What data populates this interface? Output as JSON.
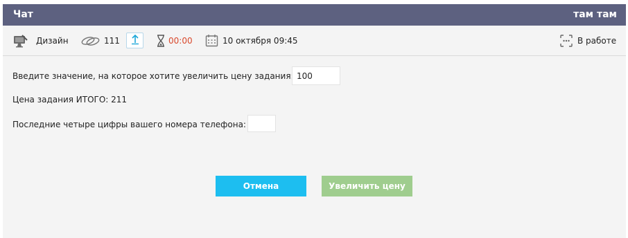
{
  "header": {
    "title": "Чат",
    "user": "там там"
  },
  "toolbar": {
    "category_icon": "category-computer-icon",
    "category": "Дизайн",
    "coins_icon": "coins-icon",
    "coins": "111",
    "raise_icon": "arrow-up-icon",
    "timer_icon": "hourglass-icon",
    "timer": "00:00",
    "date_icon": "calendar-icon",
    "date": "10 октября 09:45",
    "status_icon": "status-dots-icon",
    "status": "В работе",
    "timer_color": "#d9482b"
  },
  "form": {
    "increase_label": "Введите значение, на которое хотите увеличить цену задания:",
    "increase_value": "100",
    "total_label": "Цена задания ИТОГО: 211",
    "phone_label": "Последние четыре цифры вашего номера телефона:",
    "phone_value": ""
  },
  "buttons": {
    "cancel": "Отмена",
    "raise": "Увеличить цену",
    "cancel_color": "#1dbef0",
    "raise_color": "#9fcd8e"
  },
  "colors": {
    "header_bg": "#5d6180",
    "panel_bg": "#f4f4f4"
  }
}
